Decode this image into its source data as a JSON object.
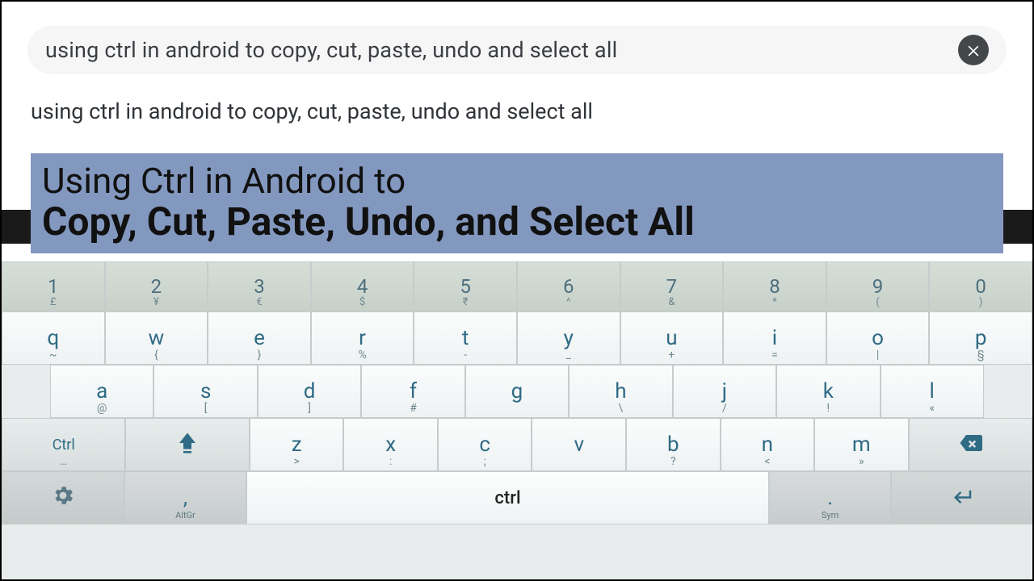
{
  "search": {
    "text": "using ctrl in android to copy, cut, paste, undo and select all"
  },
  "suggestion": "using ctrl in android to copy, cut, paste, undo and select all",
  "title": {
    "line1": "Using Ctrl in Android to",
    "line2": "Copy, Cut, Paste, Undo, and Select All"
  },
  "keyboard": {
    "numRow": [
      {
        "m": "1",
        "s": "£"
      },
      {
        "m": "2",
        "s": "¥"
      },
      {
        "m": "3",
        "s": "€"
      },
      {
        "m": "4",
        "s": "$"
      },
      {
        "m": "5",
        "s": "₹"
      },
      {
        "m": "6",
        "s": "^"
      },
      {
        "m": "7",
        "s": "&"
      },
      {
        "m": "8",
        "s": "*"
      },
      {
        "m": "9",
        "s": "("
      },
      {
        "m": "0",
        "s": ")"
      }
    ],
    "qRow": [
      {
        "m": "q",
        "s": "~"
      },
      {
        "m": "w",
        "s": "{"
      },
      {
        "m": "e",
        "s": "}"
      },
      {
        "m": "r",
        "s": "%"
      },
      {
        "m": "t",
        "s": "-"
      },
      {
        "m": "y",
        "s": "_"
      },
      {
        "m": "u",
        "s": "+"
      },
      {
        "m": "i",
        "s": "="
      },
      {
        "m": "o",
        "s": "|"
      },
      {
        "m": "p",
        "s": "§"
      }
    ],
    "aRow": [
      {
        "m": "a",
        "s": "@"
      },
      {
        "m": "s",
        "s": "["
      },
      {
        "m": "d",
        "s": "]"
      },
      {
        "m": "f",
        "s": "#"
      },
      {
        "m": "g",
        "s": ""
      },
      {
        "m": "h",
        "s": "\\"
      },
      {
        "m": "j",
        "s": "/"
      },
      {
        "m": "k",
        "s": "!"
      },
      {
        "m": "l",
        "s": "«"
      }
    ],
    "zRow": [
      {
        "m": "z",
        "s": ">"
      },
      {
        "m": "x",
        "s": ":"
      },
      {
        "m": "c",
        "s": ";"
      },
      {
        "m": "v",
        "s": ""
      },
      {
        "m": "b",
        "s": "?"
      },
      {
        "m": "n",
        "s": "<"
      },
      {
        "m": "m",
        "s": "»"
      }
    ],
    "ctrl": "Ctrl",
    "ctrlSub": "…",
    "altgr": "AltGr",
    "sym": "Sym",
    "space": "ctrl",
    "comma": ",",
    "period": "."
  }
}
